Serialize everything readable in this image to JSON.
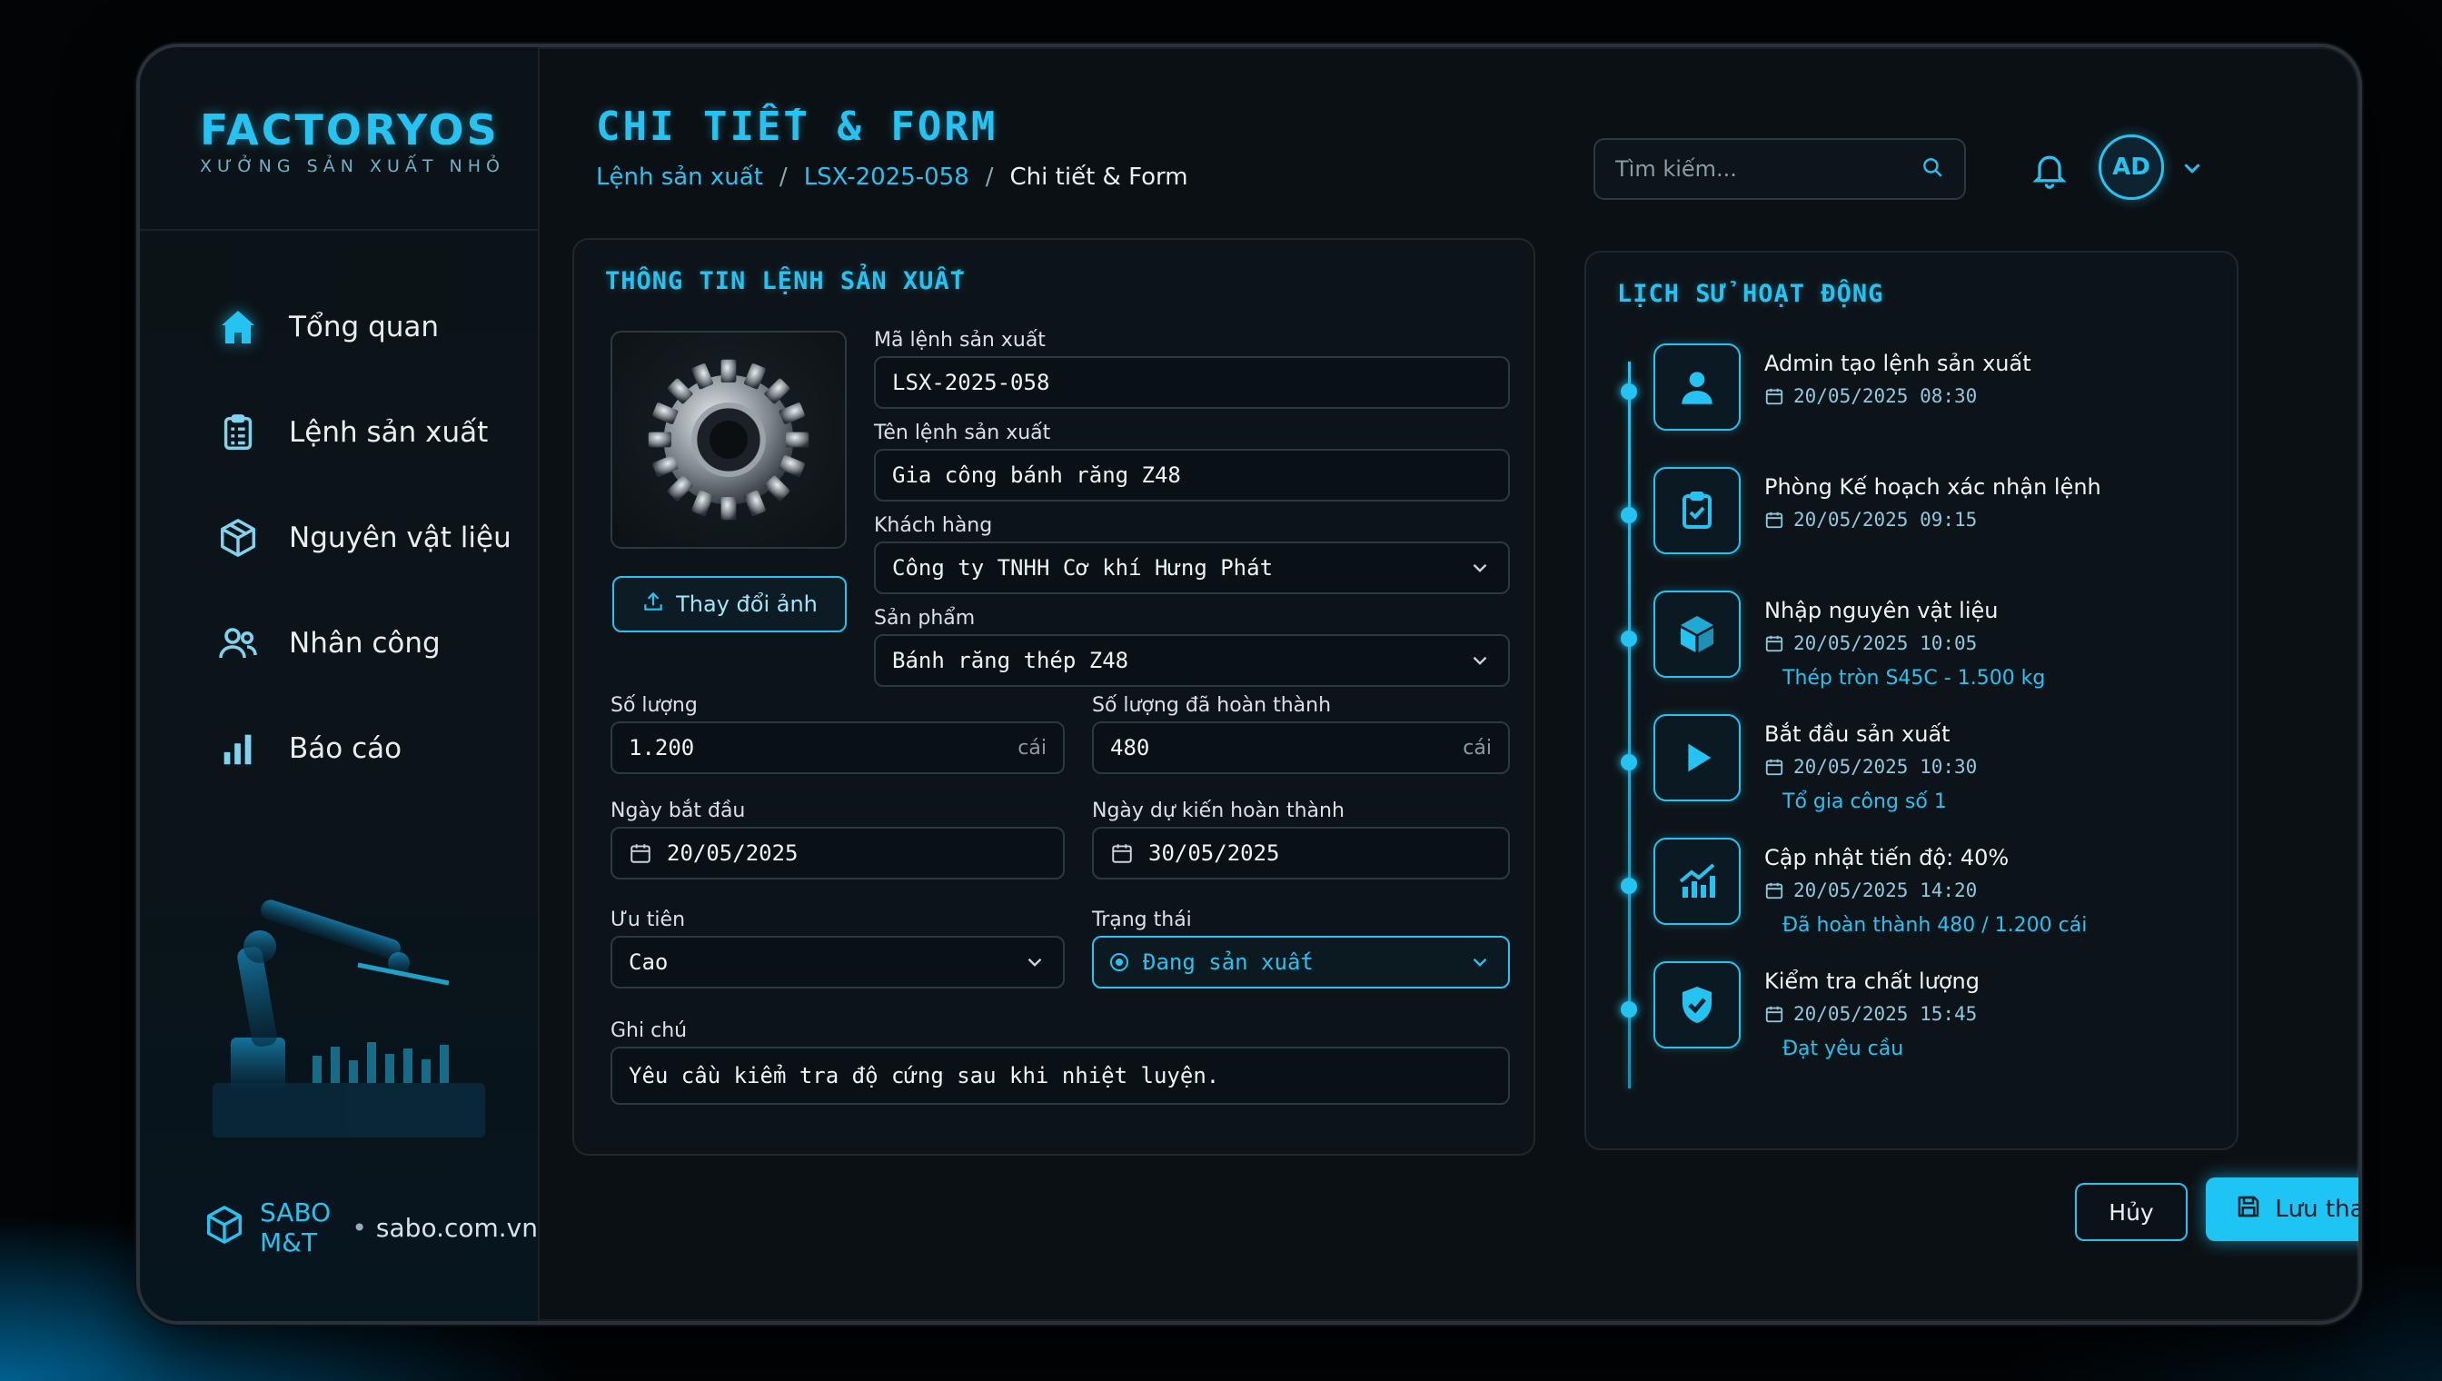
{
  "brand": {
    "title": "FACTORYOS",
    "subtitle": "XƯỞNG SẢN XUẤT NHỎ"
  },
  "sidebar": {
    "items": [
      {
        "label": "Tổng quan",
        "icon": "home-icon",
        "active": true
      },
      {
        "label": "Lệnh sản xuất",
        "icon": "clipboard-icon"
      },
      {
        "label": "Nguyên vật liệu",
        "icon": "box-icon"
      },
      {
        "label": "Nhân công",
        "icon": "users-icon"
      },
      {
        "label": "Báo cáo",
        "icon": "bar-chart-icon"
      }
    ],
    "footer": {
      "brand": "SABO M&T",
      "separator": "•",
      "url": "sabo.com.vn"
    }
  },
  "header": {
    "title": "CHI TIẾT & FORM",
    "breadcrumb": [
      "Lệnh sản xuất",
      "LSX-2025-058",
      "Chi tiết & Form"
    ],
    "breadcrumb_sep": "/",
    "search_placeholder": "Tìm kiếm...",
    "avatar": "AD"
  },
  "form": {
    "title": "THÔNG TIN LỆNH SẢN XUẤT",
    "upload_label": "Thay đổi ảnh",
    "fields": {
      "code": {
        "label": "Mã lệnh sản xuất",
        "value": "LSX-2025-058"
      },
      "name": {
        "label": "Tên lệnh sản xuất",
        "value": "Gia công bánh răng Z48"
      },
      "customer": {
        "label": "Khách hàng",
        "value": "Công ty TNHH Cơ khí Hưng Phát"
      },
      "product": {
        "label": "Sản phẩm",
        "value": "Bánh răng thép Z48"
      },
      "quantity": {
        "label": "Số lượng",
        "value": "1.200",
        "unit": "cái"
      },
      "completed": {
        "label": "Số lượng đã hoàn thành",
        "value": "480",
        "unit": "cái"
      },
      "start_date": {
        "label": "Ngày bắt đầu",
        "value": "20/05/2025"
      },
      "end_date": {
        "label": "Ngày dự kiến hoàn thành",
        "value": "30/05/2025"
      },
      "priority": {
        "label": "Ưu tiên",
        "value": "Cao"
      },
      "status": {
        "label": "Trạng thái",
        "value": "Đang sản xuất"
      },
      "note": {
        "label": "Ghi chú",
        "value": "Yêu cầu kiểm tra độ cứng sau khi nhiệt luyện."
      }
    }
  },
  "history": {
    "title": "LỊCH SỬ HOẠT ĐỘNG",
    "items": [
      {
        "title": "Admin tạo lệnh sản xuất",
        "time": "20/05/2025 08:30",
        "sub": "",
        "icon": "user-icon"
      },
      {
        "title": "Phòng Kế hoạch xác nhận lệnh",
        "time": "20/05/2025 09:15",
        "sub": "",
        "icon": "clipboard-check-icon"
      },
      {
        "title": "Nhập nguyên vật liệu",
        "time": "20/05/2025 10:05",
        "sub": "Thép tròn S45C - 1.500 kg",
        "icon": "box-icon"
      },
      {
        "title": "Bắt đầu sản xuất",
        "time": "20/05/2025 10:30",
        "sub": "Tổ gia công số 1",
        "icon": "play-icon"
      },
      {
        "title": "Cập nhật tiến độ: 40%",
        "time": "20/05/2025 14:20",
        "sub": "Đã hoàn thành 480 / 1.200 cái",
        "icon": "chart-icon"
      },
      {
        "title": "Kiểm tra chất lượng",
        "time": "20/05/2025 15:45",
        "sub": "Đạt yêu cầu",
        "icon": "shield-check-icon"
      }
    ]
  },
  "actions": {
    "cancel": "Hủy",
    "save": "Lưu thay đổi"
  },
  "colors": {
    "accent": "#25c3f2",
    "background": "#0b1014",
    "panel": "#0d1419"
  }
}
